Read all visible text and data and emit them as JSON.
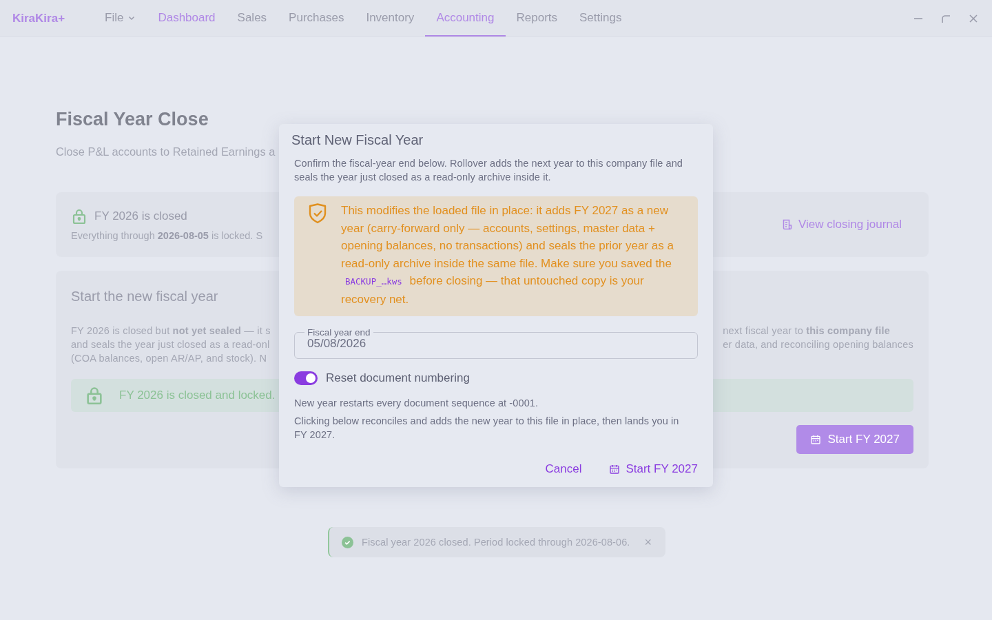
{
  "app": {
    "logo": "KiraKira+"
  },
  "nav": [
    {
      "label": "File",
      "kind": "menu",
      "selected": false,
      "hover": false
    },
    {
      "label": "Dashboard",
      "kind": "link",
      "selected": false,
      "hover": true
    },
    {
      "label": "Sales",
      "kind": "link",
      "selected": false,
      "hover": false
    },
    {
      "label": "Purchases",
      "kind": "link",
      "selected": false,
      "hover": false
    },
    {
      "label": "Inventory",
      "kind": "link",
      "selected": false,
      "hover": false
    },
    {
      "label": "Accounting",
      "kind": "link",
      "selected": true,
      "hover": false
    },
    {
      "label": "Reports",
      "kind": "link",
      "selected": false,
      "hover": false
    },
    {
      "label": "Settings",
      "kind": "link",
      "selected": false,
      "hover": false
    }
  ],
  "page": {
    "title": "Fiscal Year Close",
    "subtitle": "Close P&L accounts to Retained Earnings a"
  },
  "status_card": {
    "title": "FY 2026 is closed",
    "text": "Everything through **2026-08-05** is locked. S",
    "link": "View closing journal"
  },
  "start_card": {
    "heading": "Start the new fiscal year",
    "lines_left": [
      "FY 2026 is closed but **not yet sealed** — it s",
      "and seals the year just closed as a read-onl",
      "(COA balances, open AR/AP, and stock). N"
    ],
    "lines_right": [
      "next fiscal year to **this company file**",
      "er data, and reconciling opening balances"
    ],
    "banner": "FY 2026 is closed and locked.",
    "button": "Start FY 2027"
  },
  "dialog": {
    "title": "Start New Fiscal Year",
    "intro": "Confirm the fiscal-year end below. Rollover adds the next year to this company file and seals the year just closed as a read-only archive inside it.",
    "warning": {
      "text_before": "This modifies the loaded file in place: it adds FY 2027 as a new year (carry-forward only — accounts, settings, master data + opening balances, no transactions) and seals the prior year as a read-only archive inside the same file. Make sure you saved the",
      "code": "BACKUP_…kws",
      "text_after": "before closing — that untouched copy is your recovery net."
    },
    "field": {
      "label": "Fiscal year end",
      "value": "05/08/2026"
    },
    "toggle": {
      "label": "Reset document numbering",
      "on": true
    },
    "notes": [
      "New year restarts every document sequence at -0001.",
      "Clicking below reconciles and adds the new year to this file in place, then lands you in FY 2027."
    ],
    "cancel": "Cancel",
    "confirm": "Start FY 2027"
  },
  "toast": {
    "message": "Fiscal year 2026 closed. Period locked through 2026-08-06.",
    "close": "×"
  }
}
